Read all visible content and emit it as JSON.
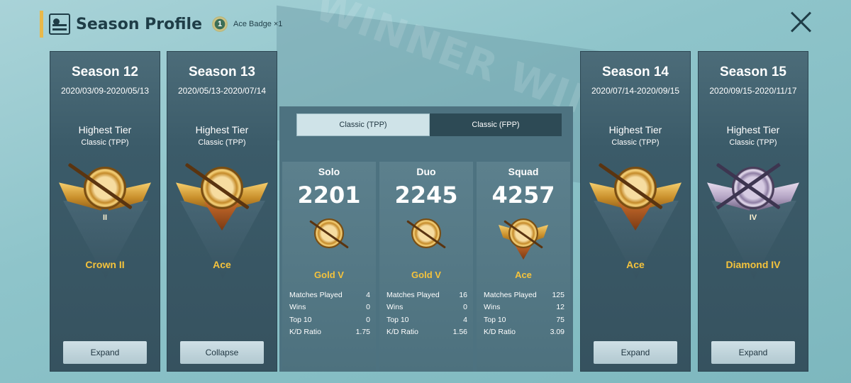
{
  "header": {
    "title": "Season Profile",
    "badge_number": "1",
    "badge_text": "Ace Badge ×1"
  },
  "background_text": "WINNER WINNER",
  "seasons": [
    {
      "name": "Season 12",
      "dates": "2020/03/09-2020/05/13",
      "tier_label": "Highest Tier",
      "mode": "Classic (TPP)",
      "tier": "Crown II",
      "tier_numeral": "II",
      "button": "Expand"
    },
    {
      "name": "Season 13",
      "dates": "2020/05/13-2020/07/14",
      "tier_label": "Highest Tier",
      "mode": "Classic (TPP)",
      "tier": "Ace",
      "button": "Collapse"
    },
    {
      "name": "Season 14",
      "dates": "2020/07/14-2020/09/15",
      "tier_label": "Highest Tier",
      "mode": "Classic (TPP)",
      "tier": "Ace",
      "button": "Expand"
    },
    {
      "name": "Season 15",
      "dates": "2020/09/15-2020/11/17",
      "tier_label": "Highest Tier",
      "mode": "Classic (TPP)",
      "tier": "Diamond IV",
      "tier_numeral": "IV",
      "button": "Expand"
    }
  ],
  "tabs": [
    {
      "label": "Classic (TPP)",
      "active": true
    },
    {
      "label": "Classic (FPP)",
      "active": false
    }
  ],
  "modes": [
    {
      "name": "Solo",
      "score": "2201",
      "tier": "Gold V",
      "stats": [
        [
          "Matches Played",
          "4"
        ],
        [
          "Wins",
          "0"
        ],
        [
          "Top 10",
          "0"
        ],
        [
          "K/D Ratio",
          "1.75"
        ]
      ]
    },
    {
      "name": "Duo",
      "score": "2245",
      "tier": "Gold V",
      "stats": [
        [
          "Matches Played",
          "16"
        ],
        [
          "Wins",
          "0"
        ],
        [
          "Top 10",
          "4"
        ],
        [
          "K/D Ratio",
          "1.56"
        ]
      ]
    },
    {
      "name": "Squad",
      "score": "4257",
      "tier": "Ace",
      "stats": [
        [
          "Matches Played",
          "125"
        ],
        [
          "Wins",
          "12"
        ],
        [
          "Top 10",
          "75"
        ],
        [
          "K/D Ratio",
          "3.09"
        ]
      ]
    }
  ],
  "colors": {
    "tier_gold": "#f5c33c",
    "accent": "#e8b84a",
    "panel": "#3b5b69"
  },
  "icons": {
    "header": "profile-card-icon",
    "badge": "ace-badge-icon",
    "close": "close-icon"
  }
}
